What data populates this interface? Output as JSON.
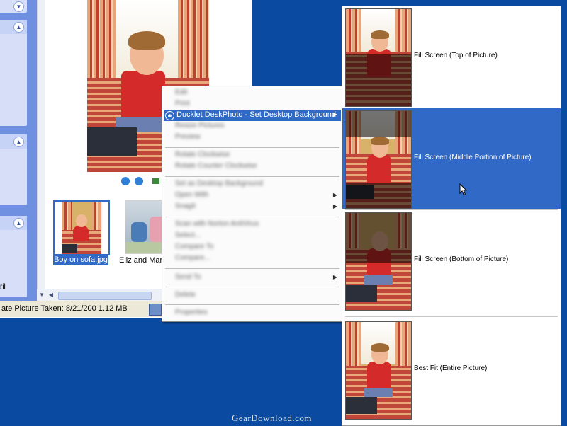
{
  "explorer": {
    "left_partial_text": "ril",
    "thumbnails": [
      {
        "label": "Boy on sofa.jpg",
        "selected": true
      },
      {
        "label": "Eliz and Maria",
        "selected": false
      }
    ],
    "status_text": "ate Picture Taken: 8/21/200 1.12 MB"
  },
  "context_menu": {
    "highlighted_item": {
      "label": "Ducklet DeskPhoto - Set Desktop Background",
      "icon": "ducklet-icon",
      "has_submenu": true
    },
    "blurred_items": [
      {
        "label": "Edit"
      },
      {
        "label": "Print"
      },
      {
        "label": "Resize Pictures"
      },
      {
        "label": "Preview"
      },
      {
        "label": "Rotate Clockwise"
      },
      {
        "label": "Rotate Counter Clockwise"
      },
      {
        "label": "Set as Desktop Background"
      },
      {
        "label": "Open With",
        "has_submenu": true
      },
      {
        "label": "SnagIt",
        "has_submenu": true
      },
      {
        "label": "Scan with Norton AntiVirus"
      },
      {
        "label": "Select..."
      },
      {
        "label": "Compare To"
      },
      {
        "label": "Compare..."
      },
      {
        "label": "Send To",
        "has_submenu": true
      },
      {
        "label": "Delete"
      },
      {
        "label": "Properties"
      }
    ]
  },
  "submenu": {
    "options": [
      {
        "label": "Fill Screen (Top of Picture)",
        "selected": false
      },
      {
        "label": "Fill Screen (Middle Portion of Picture)",
        "selected": true
      },
      {
        "label": "Fill Screen (Bottom of Picture)",
        "selected": false
      },
      {
        "label": "Best Fit (Entire Picture)",
        "selected": false
      }
    ]
  },
  "watermark": "GearDownload.com",
  "colors": {
    "desktop": "#0a4aa0",
    "selection": "#3169c6",
    "taskpane": "#6f8fe0"
  }
}
